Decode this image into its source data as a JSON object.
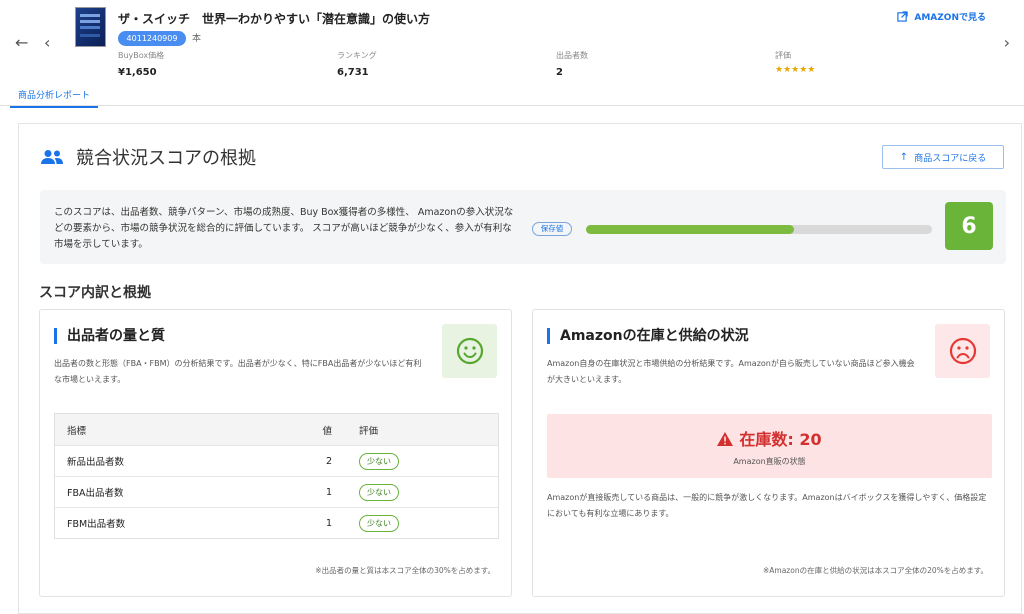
{
  "header": {
    "nav_back": "←",
    "nav_prev": "‹",
    "nav_next": "›",
    "product_title": "ザ・スイッチ　世界一わかりやすい「潜在意識」の使い方",
    "asin": "4011240909",
    "asin_suffix": "本",
    "amazon_link_label": "AMAZONで見る",
    "metrics": [
      {
        "label": "BuyBox価格",
        "value": "¥1,650"
      },
      {
        "label": "ランキング",
        "value": "6,731"
      },
      {
        "label": "出品者数",
        "value": "2"
      },
      {
        "label": "評価",
        "value": "★★★★★"
      }
    ],
    "rating": 4.5
  },
  "tabs": {
    "active": "商品分析レポート"
  },
  "section": {
    "title": "競合状況スコアの根拠",
    "back_button": "商品スコアに戻る",
    "summary": "このスコアは、出品者数、競争パターン、市場の成熟度、Buy Box獲得者の多様性、 Amazonの参入状況などの要素から、市場の競争状況を総合的に評価しています。 スコアが高いほど競争が少なく、参入が有利な市場を示しています。",
    "save_chip": "保存値",
    "score": "6",
    "score_fraction": 0.6,
    "breakdown_title": "スコア内訳と根拠"
  },
  "sellers_card": {
    "title": "出品者の量と質",
    "description": "出品者の数と形態（FBA・FBM）の分析結果です。出品者が少なく、特にFBA出品者が少ないほど有利な市場といえます。",
    "table": {
      "headers": [
        "指標",
        "値",
        "評価"
      ],
      "rows": [
        {
          "name": "新品出品者数",
          "value": "2",
          "rating": "少ない"
        },
        {
          "name": "FBA出品者数",
          "value": "1",
          "rating": "少ない"
        },
        {
          "name": "FBM出品者数",
          "value": "1",
          "rating": "少ない"
        }
      ]
    },
    "footnote": "※出品者の量と質は本スコア全体の30%を占めます。",
    "face_icon": "smile-icon",
    "accent": "#1a73e8"
  },
  "amazon_card": {
    "title": "Amazonの在庫と供給の状況",
    "description": "Amazon自身の在庫状況と市場供給の分析結果です。Amazonが自ら販売していない商品ほど参入機会が大きいといえます。",
    "stock_label": "在庫数: 20",
    "stock_sub": "Amazon直販の状態",
    "detail": "Amazonが直接販売している商品は、一般的に競争が激しくなります。Amazonはバイボックスを獲得しやすく、価格設定においても有利な立場にあります。",
    "footnote": "※Amazonの在庫と供給の状況は本スコア全体の20%を占めます。",
    "face_icon": "frown-icon"
  },
  "colors": {
    "primary": "#1a73e8",
    "success": "#6bb43a",
    "danger": "#d32f2f"
  }
}
